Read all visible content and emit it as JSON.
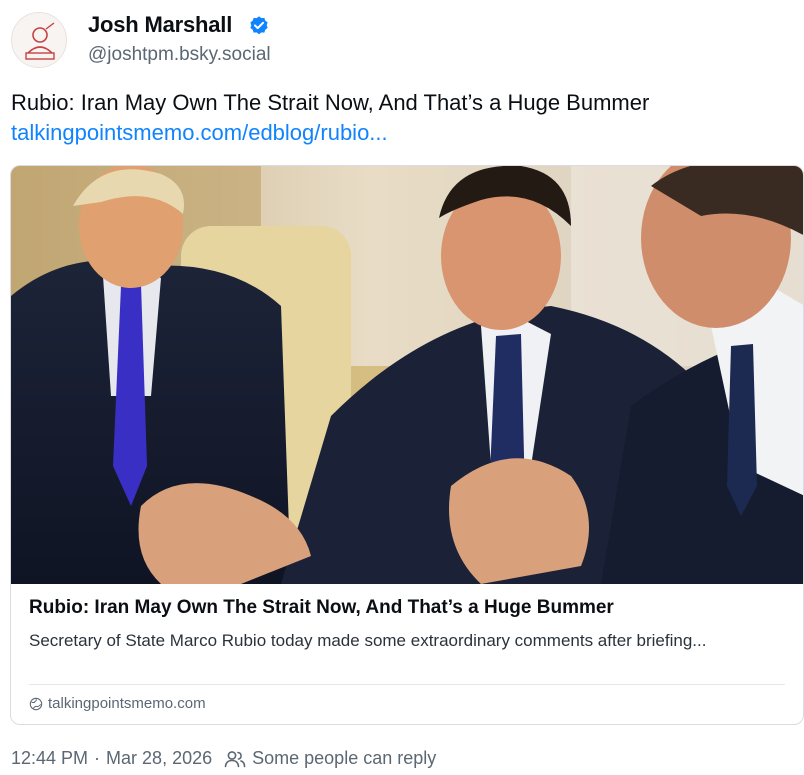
{
  "author": {
    "display_name": "Josh Marshall",
    "handle": "@joshtpm.bsky.social",
    "verified_icon": "verified-badge-icon",
    "verified_color": "#1083fe"
  },
  "post": {
    "text": "Rubio: Iran May Own The Strait Now, And That’s a Huge Bummer",
    "link_text": "talkingpointsmemo.com/edblog/rubio..."
  },
  "card": {
    "title": "Rubio: Iran May Own The Strait Now, And That’s a Huge Bummer",
    "description": "Secretary of State Marco Rubio today made some extraordinary comments after briefing...",
    "domain": "talkingpointsmemo.com",
    "domain_icon": "globe-icon"
  },
  "footer": {
    "time": "12:44 PM",
    "separator": "·",
    "date": "Mar 28, 2026",
    "reply_icon": "people-icon",
    "reply_setting": "Some people can reply"
  },
  "colors": {
    "link": "#1083fe",
    "text": "#0b0f14",
    "muted": "#5b6773",
    "border": "#d7dde3"
  }
}
